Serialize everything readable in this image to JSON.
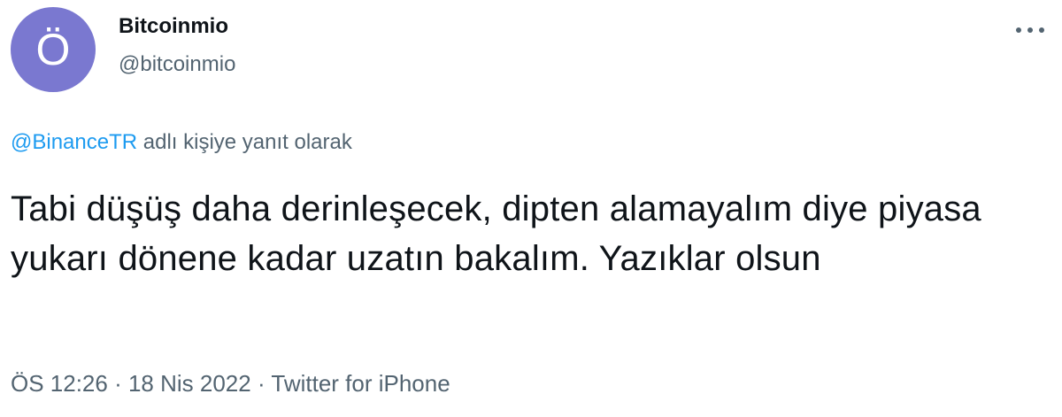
{
  "user": {
    "avatar_letter": "Ö",
    "avatar_color": "#7a78d0",
    "display_name": "Bitcoinmio",
    "username": "@bitcoinmio"
  },
  "more_icon": "more-horizontal-icon",
  "reply": {
    "mention": "@BinanceTR",
    "suffix": " adlı kişiye yanıt olarak"
  },
  "tweet": {
    "text": "Tabi düşüş daha derinleşecek, dipten alamayalım diye piyasa yukarı dönene kadar uzatın bakalım. Yazıklar olsun"
  },
  "meta": {
    "time": "ÖS 12:26",
    "separator": " · ",
    "date": "18 Nis 2022",
    "source": "Twitter for iPhone"
  },
  "colors": {
    "link": "#1d9bf0",
    "secondary_text": "#536471",
    "primary_text": "#0f1419"
  }
}
